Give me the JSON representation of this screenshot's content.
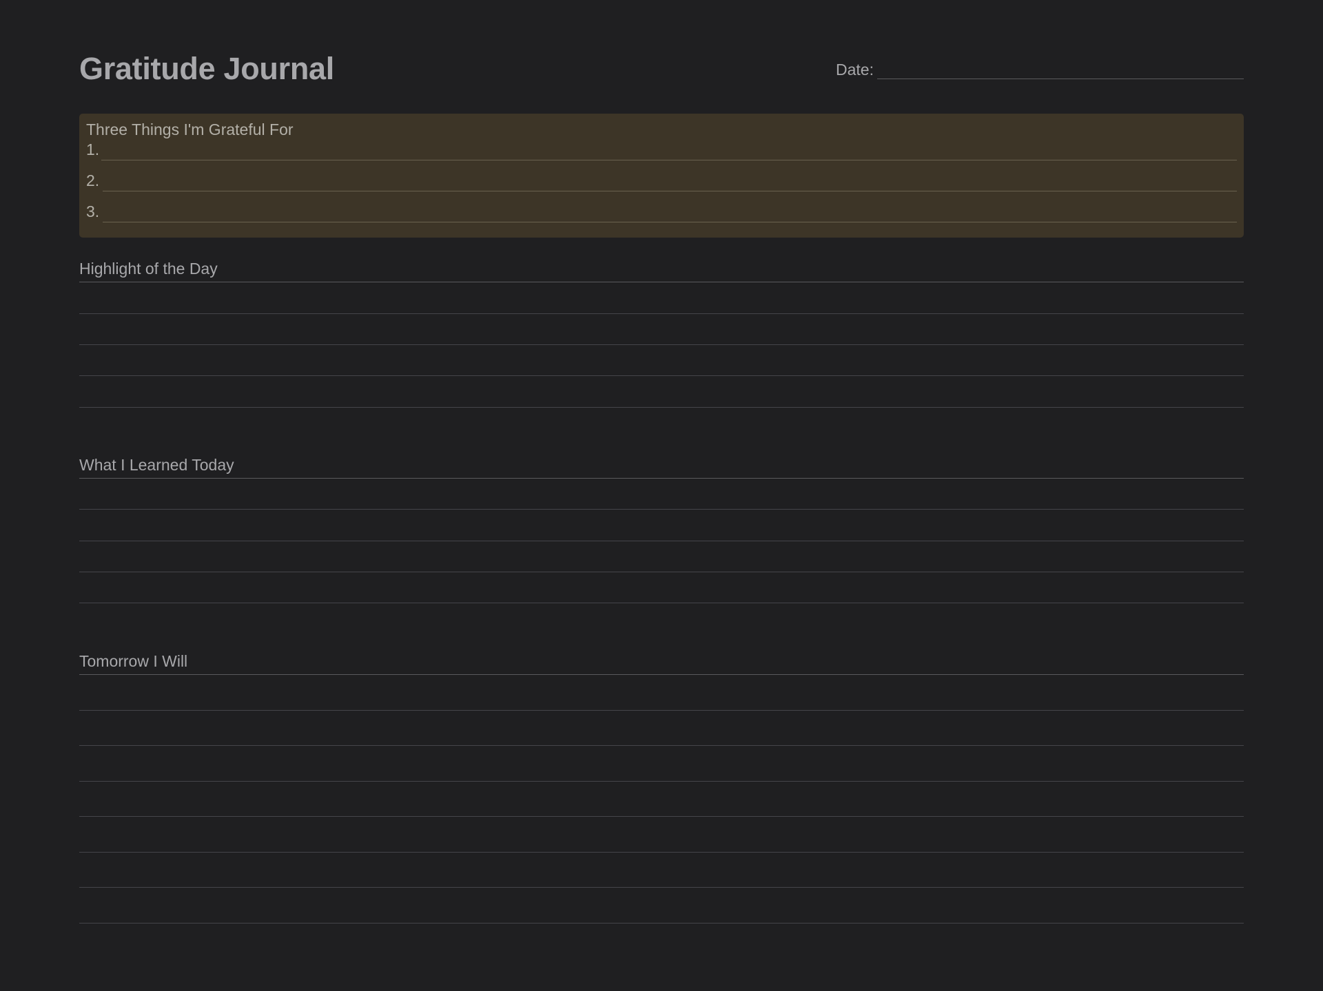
{
  "header": {
    "title": "Gratitude Journal",
    "date_label": "Date:"
  },
  "grateful": {
    "title": "Three Things I'm Grateful For",
    "items": [
      {
        "number": "1."
      },
      {
        "number": "2."
      },
      {
        "number": "3."
      }
    ]
  },
  "sections": {
    "highlight": {
      "title": "Highlight of the Day"
    },
    "learned": {
      "title": "What I Learned Today"
    },
    "tomorrow": {
      "title": "Tomorrow I Will"
    }
  },
  "colors": {
    "background": "#1f1f21",
    "grateful_box": "#3d3527",
    "text": "#a8a8ab"
  }
}
